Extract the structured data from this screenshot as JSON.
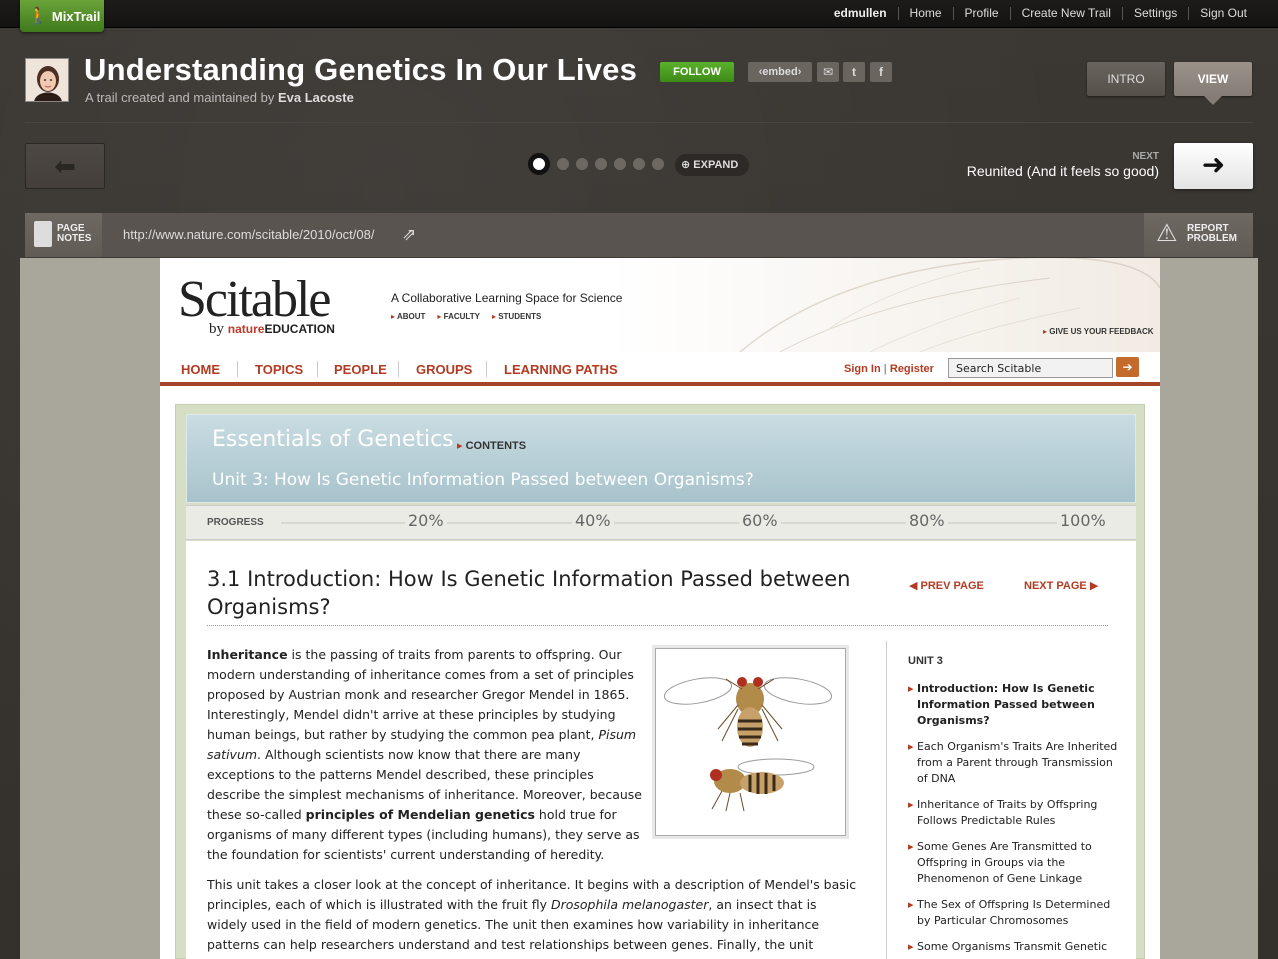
{
  "app": {
    "logo": "MixTrail"
  },
  "user_nav": [
    "edmullen",
    "Home",
    "Profile",
    "Create New Trail",
    "Settings",
    "Sign Out"
  ],
  "trail": {
    "title": "Understanding Genetics In Our Lives",
    "subtitle_prefix": "A trail created and maintained by",
    "author": "Eva Lacoste",
    "follow_label": "FOLLOW",
    "embed_label": "‹embed›",
    "share": [
      "mail-icon",
      "twitter-icon",
      "facebook-icon"
    ]
  },
  "modes": {
    "intro": "INTRO",
    "view": "VIEW",
    "active": "view"
  },
  "navigation": {
    "steps_total": 7,
    "current_step": 1,
    "expand_label": "EXPAND",
    "next_label": "NEXT",
    "next_title": "Reunited (And it feels so good)"
  },
  "urlbar": {
    "page_notes": [
      "PAGE",
      "NOTES"
    ],
    "url": "http://www.nature.com/scitable/2010/oct/08/",
    "report": [
      "REPORT",
      "PROBLEM"
    ]
  },
  "site": {
    "logo": "Scitable",
    "by": "by",
    "nature": "nature",
    "education": "EDUCATION",
    "tagline": "A Collaborative Learning Space for Science",
    "sublinks": [
      "ABOUT",
      "FACULTY",
      "STUDENTS"
    ],
    "feedback": "GIVE US YOUR FEEDBACK",
    "nav": [
      "HOME",
      "TOPICS",
      "PEOPLE",
      "GROUPS",
      "LEARNING PATHS"
    ],
    "sign_in": "Sign In",
    "register": "Register",
    "search_value": "Search Scitable"
  },
  "course": {
    "title": "Essentials of Genetics",
    "contents_label": "CONTENTS",
    "unit": "Unit 3: How Is Genetic Information Passed between Organisms?",
    "progress_label": "PROGRESS",
    "progress_ticks": [
      "20%",
      "40%",
      "60%",
      "80%",
      "100%"
    ]
  },
  "article": {
    "title": "3.1  Introduction: How Is Genetic Information Passed between Organisms?",
    "prev_page": "PREV PAGE",
    "next_page": "NEXT PAGE",
    "p1": {
      "b1": "Inheritance",
      "t1": " is the passing of traits from parents to offspring. Our modern understanding of inheritance comes from a set of principles proposed by Austrian monk and researcher Gregor Mendel in 1865. Interestingly, Mendel didn't arrive at these principles by studying human beings, but rather by studying the common pea plant, ",
      "i1": "Pisum sativum",
      "t2": ". Although scientists now know that there are many exceptions to the patterns Mendel described, these principles describe the simplest mechanisms of inheritance. Moreover, because these so-called ",
      "b2": "principles of Mendelian genetics",
      "t3": " hold true for organisms of many different types (including humans), they serve as the foundation for scientists' current understanding of heredity."
    },
    "p2": {
      "t1": "This unit takes a closer look at the concept of inheritance. It begins with a description of Mendel's basic principles, each of which is illustrated with the fruit fly ",
      "i1": "Drosophila melanogaster",
      "t2": ", an insect that is widely used in the field of modern genetics. The unit then examines how variability in inheritance patterns can help researchers understand and test relationships between genes. Finally, the unit"
    }
  },
  "sidebar": {
    "heading": "UNIT 3",
    "items": [
      "Introduction: How Is Genetic Information Passed between Organisms?",
      "Each Organism's Traits Are Inherited from a Parent through Transmission of DNA",
      "Inheritance of Traits by Offspring Follows Predictable Rules",
      "Some Genes Are Transmitted to Offspring in Groups via the Phenomenon of Gene Linkage",
      "The Sex of Offspring Is Determined by Particular Chromosomes",
      "Some Organisms Transmit Genetic"
    ]
  }
}
